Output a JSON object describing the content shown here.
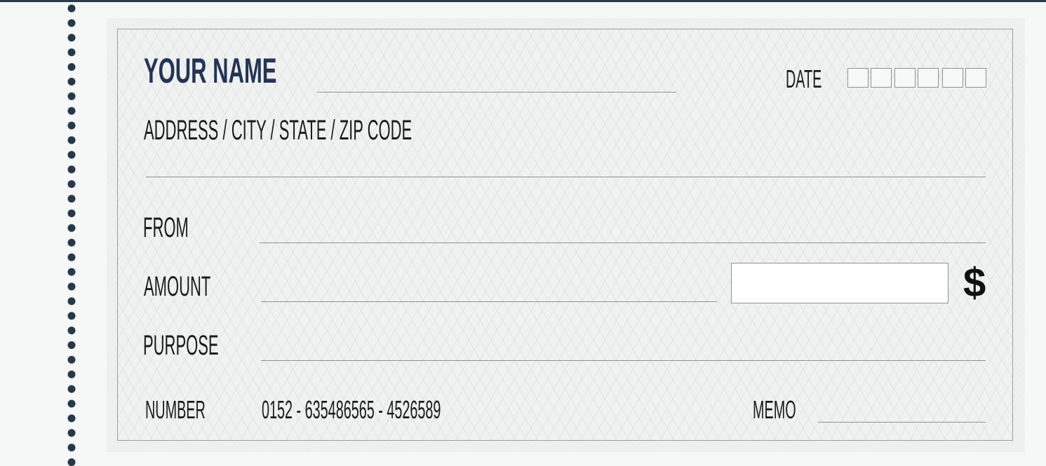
{
  "check": {
    "name": "YOUR NAME",
    "address": "ADDRESS / CITY / STATE / ZIP CODE",
    "date_label": "DATE",
    "date_boxes": [
      "",
      "",
      "",
      "",
      "",
      ""
    ],
    "from_label": "FROM",
    "amount_label": "AMOUNT",
    "currency_symbol": "$",
    "purpose_label": "PURPOSE",
    "number_label": "NUMBER",
    "number_value": "0152 - 635486565 - 4526589",
    "memo_label": "MEMO"
  },
  "colors": {
    "name_text": "#233555",
    "perforation": "#283846",
    "top_bar": "#2a3a48",
    "check_background": "#f0f1f1",
    "rule_lines": "#8e9294"
  }
}
